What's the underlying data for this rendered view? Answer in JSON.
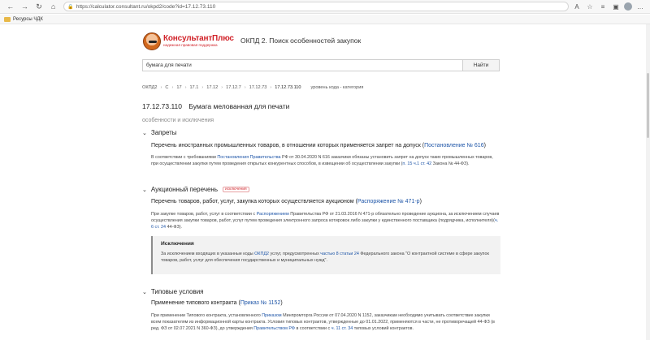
{
  "browser": {
    "url": "https://calculator.consultant.ru/okpd2/code?id=17.12.73.110",
    "bookmark": "Ресурсы ЧДК"
  },
  "logo": {
    "title": "КонсультантПлюс",
    "subtitle": "надежная правовая поддержка"
  },
  "page_title": "ОКПД 2. Поиск особенностей закупок",
  "search": {
    "value": "бумага для печати",
    "button": "Найти"
  },
  "breadcrumb": {
    "items": [
      "ОКПД2",
      "C",
      "17",
      "17.1",
      "17.12",
      "17.12.7",
      "17.12.73"
    ],
    "current": "17.12.73.110",
    "extra": "уровень кода - категория"
  },
  "code": {
    "number": "17.12.73.110",
    "name": "Бумага мелованная для печати"
  },
  "features_heading": "особенности и исключения",
  "sections": {
    "bans": {
      "title": "Запреты",
      "subtitle_text": "Перечень иностранных промышленных товаров, в отношении которых применяется запрет на допуск (",
      "subtitle_link": "Постановление № 616",
      "subtitle_end": ")",
      "p1": "В соответствии с требованиями ",
      "p1_link": "Постановления Правительства",
      "p2": " РФ от 30.04.2020 N 616 заказчики обязаны установить запрет на допуск таких промышленных товаров, при осуществлении закупки путем проведения открытых конкурентных способов, в извещении об осуществлении закупки (",
      "p2_link": "п. 15 ч.1 ст. 42",
      "p3": " Закона  № 44-ФЗ)."
    },
    "auction": {
      "title": "Аукционный перечень",
      "tag": "исключения",
      "subtitle_text": "Перечень товаров, работ, услуг, закупка которых осуществляется аукционом (",
      "subtitle_link": "Распоряжение № 471-р",
      "subtitle_end": ")",
      "p1": "При закупке товаров, работ, услуг в соответствии с ",
      "p1_link": "Распоряжением",
      "p2": " Правительства РФ от 21.03.2016 N 471-р обязательно проведение аукциона, за исключением случаев осуществления закупки товаров, работ, услуг путем проведения электронного запроса котировок либо закупки у единственного поставщика (подрядчика, исполнителя)(",
      "p2_link": "ч. 6 ст. 24",
      "p3": " 44-ФЗ).",
      "exceptions_title": "Исключения",
      "exc1": "За исключением входящих в указанные коды ",
      "exc1_link": "ОКПД2",
      "exc2": " услуг, предусмотренных ",
      "exc2_link": "частью 8 статьи 24",
      "exc3": " Федерального закона \"О контрактной системе в сфере закупок товаров, работ, услуг для обеспечения государственных и муниципальных нужд\"."
    },
    "standard": {
      "title": "Типовые условия",
      "subtitle_text": "Применение типового контракта (",
      "subtitle_link": "Приказ № 1152",
      "subtitle_end": ")",
      "p1": "При применении Типового контракта, установленного ",
      "p1_link": "Приказом",
      "p2": " Минпромторга России от 07.04.2020 N 1152, заказчикам необходимо учитывать соответствие закупки всем показателям из информационной карты контракта. Условия типовых контрактов, утвержденные до 01.01.2022, применяются в части, не противоречащей 44-ФЗ (в ред. ФЗ от 02.07.2021 N 360-ФЗ), до утверждения ",
      "p2_link": "Правительством РФ",
      "p3": " в соответствии с ",
      "p3_link": "ч. 11 ст. 34",
      "p4": " типовых условий контрактов."
    }
  }
}
